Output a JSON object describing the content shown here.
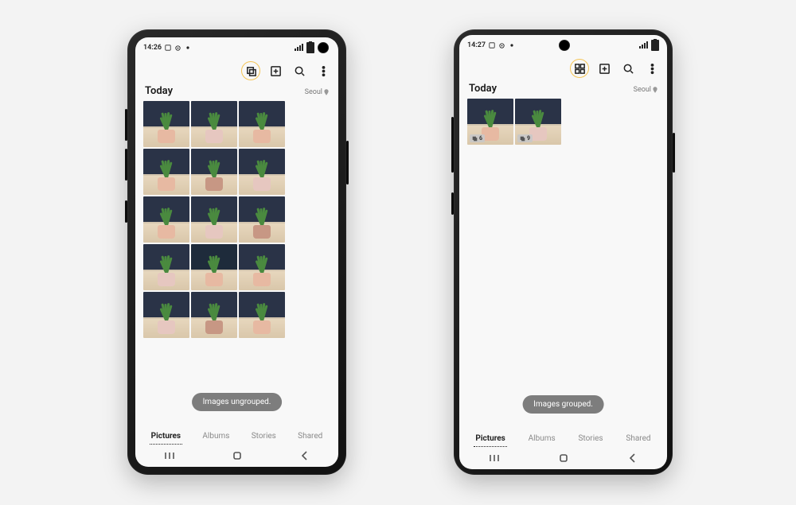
{
  "left": {
    "time": "14:26",
    "section_title": "Today",
    "location": "Seoul",
    "toast": "Images ungrouped.",
    "tabs": [
      "Pictures",
      "Albums",
      "Stories",
      "Shared"
    ],
    "active_tab": "Pictures",
    "group_icon": "stack",
    "thumbnail_variants": [
      "a",
      "b",
      "a",
      "a",
      "c",
      "b",
      "a",
      "b",
      "c",
      "b",
      "d",
      "a",
      "b",
      "c",
      "a"
    ]
  },
  "right": {
    "time": "14:27",
    "section_title": "Today",
    "location": "Seoul",
    "toast": "Images grouped.",
    "tabs": [
      "Pictures",
      "Albums",
      "Stories",
      "Shared"
    ],
    "active_tab": "Pictures",
    "group_icon": "grid",
    "groups": [
      {
        "variant": "a",
        "count": 6
      },
      {
        "variant": "b",
        "count": 9
      }
    ]
  }
}
